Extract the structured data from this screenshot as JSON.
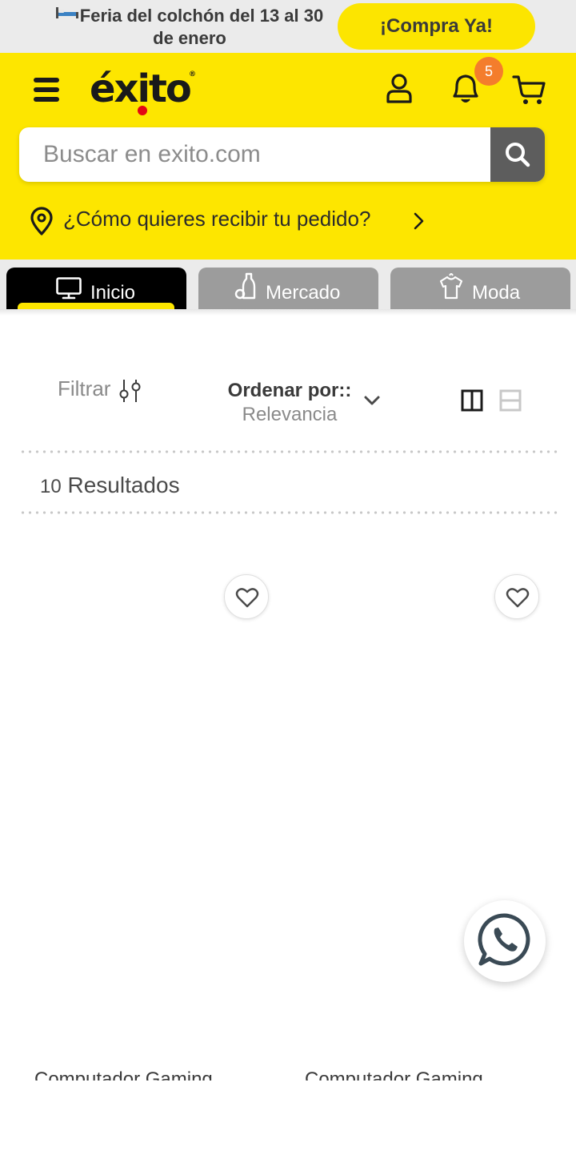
{
  "promo": {
    "text": "Feria del colchón del 13 al 30 de enero",
    "button": "¡Compra Ya!"
  },
  "header": {
    "logo": "éxito",
    "notifications_count": "5",
    "search_placeholder": "Buscar en exito.com",
    "delivery_prompt": "¿Cómo quieres recibir tu pedido?"
  },
  "tabs": [
    {
      "label": "Inicio",
      "icon": "monitor-icon",
      "active": true
    },
    {
      "label": "Mercado",
      "icon": "bottle-icon",
      "active": false
    },
    {
      "label": "Moda",
      "icon": "shirt-icon",
      "active": false
    }
  ],
  "toolbar": {
    "filter_label": "Filtrar",
    "sort_label": "Ordenar por::",
    "sort_value": "Relevancia"
  },
  "results": {
    "count": "10",
    "label": "Resultados"
  },
  "products": [
    {
      "name": "Computador Gaming"
    },
    {
      "name": "Computador Gaming"
    }
  ],
  "colors": {
    "brand_yellow": "#fde600",
    "badge_orange": "#f47d2c",
    "logo_red": "#e30613",
    "tab_active": "#000000",
    "tab_inactive": "#9c9c9c"
  }
}
